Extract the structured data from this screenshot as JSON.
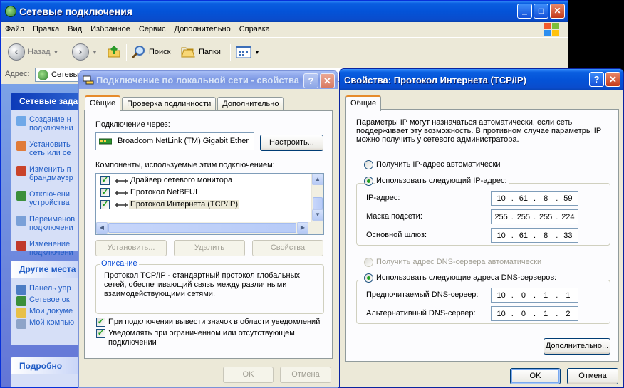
{
  "explorer": {
    "title": "Сетевые подключения",
    "menu": [
      "Файл",
      "Правка",
      "Вид",
      "Избранное",
      "Сервис",
      "Дополнительно",
      "Справка"
    ],
    "toolbar": {
      "back": "Назад",
      "search": "Поиск",
      "folders": "Папки"
    },
    "address": {
      "label": "Адрес:",
      "value": "Сетевы"
    },
    "tasks": {
      "network_title": "Сетевые зада",
      "network_items": [
        {
          "label": "Создание н подключени",
          "icon": "new-connection-icon"
        },
        {
          "label": "Установить сеть или се",
          "icon": "home-network-icon"
        },
        {
          "label": "Изменить п брандмауэр",
          "icon": "firewall-icon"
        },
        {
          "label": "Отключени устройства",
          "icon": "disable-device-icon"
        },
        {
          "label": "Переименов подключени",
          "icon": "rename-icon"
        },
        {
          "label": "Изменение подключени",
          "icon": "change-settings-icon"
        }
      ],
      "other_title": "Другие места",
      "other_items": [
        {
          "label": "Панель упр",
          "icon": "control-panel-icon"
        },
        {
          "label": "Сетевое ок",
          "icon": "network-places-icon"
        },
        {
          "label": "Мои докуме",
          "icon": "my-documents-icon"
        },
        {
          "label": "Мой компью",
          "icon": "my-computer-icon"
        }
      ],
      "details_title": "Подробно"
    }
  },
  "lan_dialog": {
    "title": "Подключение по локальной сети - свойства",
    "help": "?",
    "close": "✕",
    "tabs": [
      "Общие",
      "Проверка подлинности",
      "Дополнительно"
    ],
    "connect_using_label": "Подключение через:",
    "adapter_name": "Broadcom NetLink (TM) Gigabit Ether",
    "configure_button": "Настроить...",
    "components_label": "Компоненты, используемые этим подключением:",
    "components": [
      {
        "label": "Драйвер сетевого монитора",
        "checked": true
      },
      {
        "label": "Протокол NetBEUI",
        "checked": true
      },
      {
        "label": "Протокол Интернета (TCP/IP)",
        "checked": true,
        "selected": true
      }
    ],
    "install_button": "Установить...",
    "uninstall_button": "Удалить",
    "properties_button": "Свойства",
    "description_title": "Описание",
    "description_text": "Протокол TCP/IP - стандартный протокол глобальных сетей, обеспечивающий связь между различными взаимодействующими сетями.",
    "show_icon_label": "При подключении вывести значок в области уведомлений",
    "show_icon_checked": true,
    "notify_label": "Уведомлять при ограниченном или отсутствующем подключении",
    "notify_checked": true,
    "ok_button": "OK",
    "cancel_button": "Отмена"
  },
  "tcpip_dialog": {
    "title": "Свойства: Протокол Интернета (TCP/IP)",
    "help": "?",
    "close": "✕",
    "tab": "Общие",
    "intro": "Параметры IP могут назначаться автоматически, если сеть поддерживает эту возможность. В противном случае параметры IP можно получить у сетевого администратора.",
    "auto_ip_label": "Получить IP-адрес автоматически",
    "auto_ip_selected": false,
    "manual_ip_label": "Использовать следующий IP-адрес:",
    "manual_ip_selected": true,
    "ip_label": "IP-адрес:",
    "ip": [
      "10",
      "61",
      "8",
      "59"
    ],
    "mask_label": "Маска подсети:",
    "mask": [
      "255",
      "255",
      "255",
      "224"
    ],
    "gateway_label": "Основной шлюз:",
    "gateway": [
      "10",
      "61",
      "8",
      "33"
    ],
    "auto_dns_label": "Получить адрес DNS-сервера автоматически",
    "auto_dns_enabled": false,
    "manual_dns_label": "Использовать следующие адреса DNS-серверов:",
    "manual_dns_selected": true,
    "preferred_dns_label": "Предпочитаемый DNS-сервер:",
    "preferred_dns": [
      "10",
      "0",
      "1",
      "1"
    ],
    "alternate_dns_label": "Альтернативный DNS-сервер:",
    "alternate_dns": [
      "10",
      "0",
      "1",
      "2"
    ],
    "advanced_button": "Дополнительно...",
    "ok_button": "OK",
    "cancel_button": "Отмена"
  }
}
